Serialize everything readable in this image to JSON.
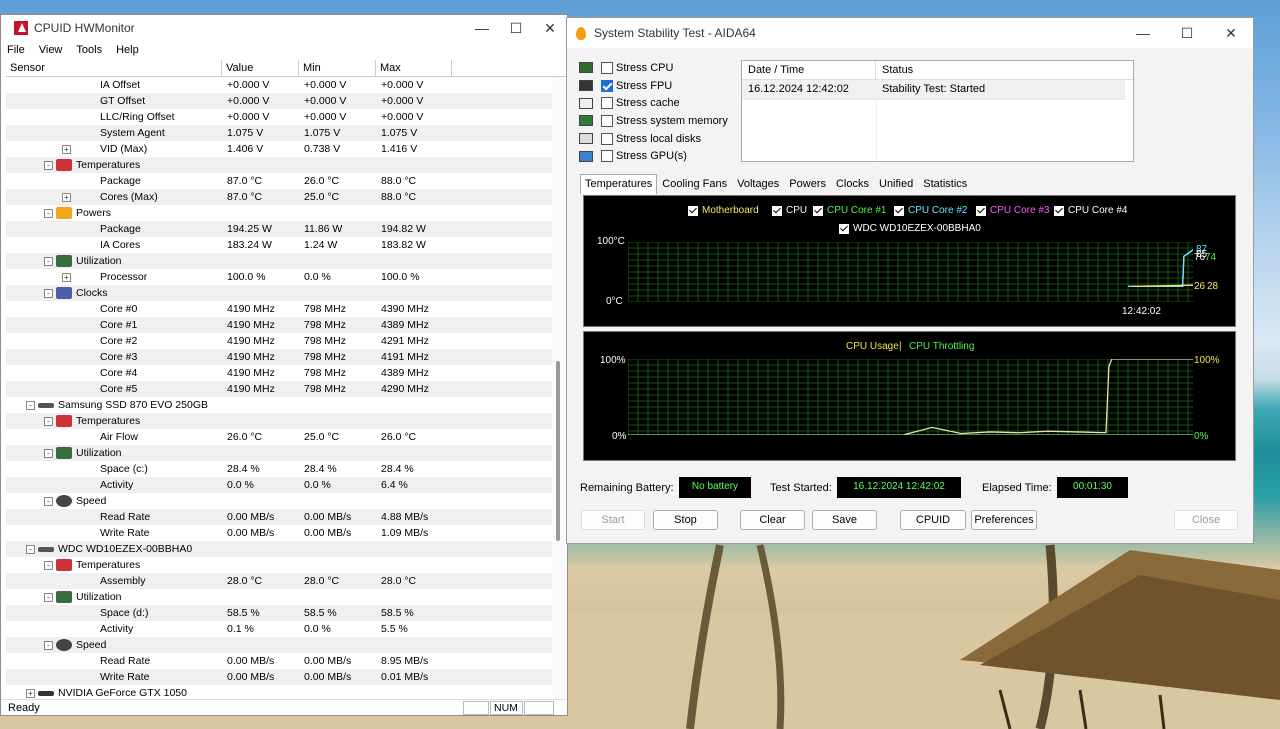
{
  "hw": {
    "title": "CPUID HWMonitor",
    "menu": [
      "File",
      "View",
      "Tools",
      "Help"
    ],
    "columns": [
      "Sensor",
      "Value",
      "Min",
      "Max"
    ],
    "rows": [
      {
        "lvl": 3,
        "label": "IA Offset",
        "v": "+0.000 V",
        "min": "+0.000 V",
        "max": "+0.000 V"
      },
      {
        "lvl": 3,
        "label": "GT Offset",
        "v": "+0.000 V",
        "min": "+0.000 V",
        "max": "+0.000 V"
      },
      {
        "lvl": 3,
        "label": "LLC/Ring Offset",
        "v": "+0.000 V",
        "min": "+0.000 V",
        "max": "+0.000 V"
      },
      {
        "lvl": 3,
        "label": "System Agent",
        "v": "1.075 V",
        "min": "1.075 V",
        "max": "1.075 V"
      },
      {
        "lvl": 3,
        "label": "VID (Max)",
        "v": "1.406 V",
        "min": "0.738 V",
        "max": "1.416 V",
        "exp": "+"
      },
      {
        "lvl": 2,
        "label": "Temperatures",
        "icon": "thermometer",
        "exp": "-"
      },
      {
        "lvl": 3,
        "label": "Package",
        "v": "87.0 °C",
        "min": "26.0 °C",
        "max": "88.0 °C"
      },
      {
        "lvl": 3,
        "label": "Cores (Max)",
        "v": "87.0 °C",
        "min": "25.0 °C",
        "max": "88.0 °C",
        "exp": "+"
      },
      {
        "lvl": 2,
        "label": "Powers",
        "icon": "power",
        "exp": "-"
      },
      {
        "lvl": 3,
        "label": "Package",
        "v": "194.25 W",
        "min": "11.86 W",
        "max": "194.82 W"
      },
      {
        "lvl": 3,
        "label": "IA Cores",
        "v": "183.24 W",
        "min": "1.24 W",
        "max": "183.82 W"
      },
      {
        "lvl": 2,
        "label": "Utilization",
        "icon": "utilization",
        "exp": "-"
      },
      {
        "lvl": 3,
        "label": "Processor",
        "v": "100.0 %",
        "min": "0.0 %",
        "max": "100.0 %",
        "exp": "+"
      },
      {
        "lvl": 2,
        "label": "Clocks",
        "icon": "clock",
        "exp": "-"
      },
      {
        "lvl": 3,
        "label": "Core #0",
        "v": "4190 MHz",
        "min": "798 MHz",
        "max": "4390 MHz"
      },
      {
        "lvl": 3,
        "label": "Core #1",
        "v": "4190 MHz",
        "min": "798 MHz",
        "max": "4389 MHz"
      },
      {
        "lvl": 3,
        "label": "Core #2",
        "v": "4190 MHz",
        "min": "798 MHz",
        "max": "4291 MHz"
      },
      {
        "lvl": 3,
        "label": "Core #3",
        "v": "4190 MHz",
        "min": "798 MHz",
        "max": "4191 MHz"
      },
      {
        "lvl": 3,
        "label": "Core #4",
        "v": "4190 MHz",
        "min": "798 MHz",
        "max": "4389 MHz"
      },
      {
        "lvl": 3,
        "label": "Core #5",
        "v": "4190 MHz",
        "min": "798 MHz",
        "max": "4290 MHz"
      },
      {
        "lvl": 1,
        "label": "Samsung SSD 870 EVO 250GB",
        "icon": "drive",
        "exp": "-"
      },
      {
        "lvl": 2,
        "label": "Temperatures",
        "icon": "thermometer",
        "exp": "-"
      },
      {
        "lvl": 3,
        "label": "Air Flow",
        "v": "26.0 °C",
        "min": "25.0 °C",
        "max": "26.0 °C"
      },
      {
        "lvl": 2,
        "label": "Utilization",
        "icon": "utilization",
        "exp": "-"
      },
      {
        "lvl": 3,
        "label": "Space (c:)",
        "v": "28.4 %",
        "min": "28.4 %",
        "max": "28.4 %"
      },
      {
        "lvl": 3,
        "label": "Activity",
        "v": "0.0 %",
        "min": "0.0 %",
        "max": "6.4 %"
      },
      {
        "lvl": 2,
        "label": "Speed",
        "icon": "speed",
        "exp": "-"
      },
      {
        "lvl": 3,
        "label": "Read Rate",
        "v": "0.00 MB/s",
        "min": "0.00 MB/s",
        "max": "4.88 MB/s"
      },
      {
        "lvl": 3,
        "label": "Write Rate",
        "v": "0.00 MB/s",
        "min": "0.00 MB/s",
        "max": "1.09 MB/s"
      },
      {
        "lvl": 1,
        "label": "WDC WD10EZEX-00BBHA0",
        "icon": "drive",
        "exp": "-"
      },
      {
        "lvl": 2,
        "label": "Temperatures",
        "icon": "thermometer",
        "exp": "-"
      },
      {
        "lvl": 3,
        "label": "Assembly",
        "v": "28.0 °C",
        "min": "28.0 °C",
        "max": "28.0 °C"
      },
      {
        "lvl": 2,
        "label": "Utilization",
        "icon": "utilization",
        "exp": "-"
      },
      {
        "lvl": 3,
        "label": "Space (d:)",
        "v": "58.5 %",
        "min": "58.5 %",
        "max": "58.5 %"
      },
      {
        "lvl": 3,
        "label": "Activity",
        "v": "0.1 %",
        "min": "0.0 %",
        "max": "5.5 %"
      },
      {
        "lvl": 2,
        "label": "Speed",
        "icon": "speed",
        "exp": "-"
      },
      {
        "lvl": 3,
        "label": "Read Rate",
        "v": "0.00 MB/s",
        "min": "0.00 MB/s",
        "max": "8.95 MB/s"
      },
      {
        "lvl": 3,
        "label": "Write Rate",
        "v": "0.00 MB/s",
        "min": "0.00 MB/s",
        "max": "0.01 MB/s"
      },
      {
        "lvl": 1,
        "label": "NVIDIA GeForce GTX 1050",
        "icon": "gpu",
        "exp": "+"
      }
    ],
    "status": {
      "ready": "Ready",
      "num": "NUM"
    }
  },
  "aida": {
    "title": "System Stability Test - AIDA64",
    "stress": [
      {
        "label": "Stress CPU",
        "checked": false,
        "icon": "cpu-icon"
      },
      {
        "label": "Stress FPU",
        "checked": true,
        "icon": "fpu-icon"
      },
      {
        "label": "Stress cache",
        "checked": false,
        "icon": "cache-icon"
      },
      {
        "label": "Stress system memory",
        "checked": false,
        "icon": "memory-icon"
      },
      {
        "label": "Stress local disks",
        "checked": false,
        "icon": "disk-icon"
      },
      {
        "label": "Stress GPU(s)",
        "checked": false,
        "icon": "monitor-icon"
      }
    ],
    "log": {
      "headers": [
        "Date / Time",
        "Status"
      ],
      "rows": [
        [
          "16.12.2024 12:42:02",
          "Stability Test: Started"
        ]
      ]
    },
    "tabs": [
      "Temperatures",
      "Cooling Fans",
      "Voltages",
      "Powers",
      "Clocks",
      "Unified",
      "Statistics"
    ],
    "temp_legend": [
      {
        "label": "Motherboard",
        "color": "#f5e56b"
      },
      {
        "label": "CPU",
        "color": "#ffffff"
      },
      {
        "label": "CPU Core #1",
        "color": "#54f054"
      },
      {
        "label": "CPU Core #2",
        "color": "#61e6ff"
      },
      {
        "label": "CPU Core #3",
        "color": "#ff5bff"
      },
      {
        "label": "CPU Core #4",
        "color": "#ffffff"
      },
      {
        "label": "WDC WD10EZEX-00BBHA0",
        "color": "#ffffff"
      }
    ],
    "temp_axis": {
      "top": "100°C",
      "bottom": "0°C",
      "time": "12:42:02"
    },
    "temp_right": {
      "a": "87",
      "b": "85",
      "c": "76",
      "d": "74",
      "e": "26",
      "f": "28"
    },
    "usage_legend": {
      "usage": "CPU Usage",
      "sep": "|",
      "throttle": "CPU Throttling"
    },
    "usage_axis": {
      "top_l": "100%",
      "bottom_l": "0%",
      "top_r": "100%",
      "bottom_r": "0%"
    },
    "info": {
      "battery_label": "Remaining Battery:",
      "battery": "No battery",
      "started_label": "Test Started:",
      "started": "16.12.2024 12:42:02",
      "elapsed_label": "Elapsed Time:",
      "elapsed": "00:01:30"
    },
    "buttons": {
      "start": "Start",
      "stop": "Stop",
      "clear": "Clear",
      "save": "Save",
      "cpuid": "CPUID",
      "prefs": "Preferences",
      "close": "Close"
    }
  },
  "chart_data": [
    {
      "type": "line",
      "title": "",
      "series": [
        {
          "name": "CPU Core #1",
          "x": [
            0,
            84,
            86,
            100
          ],
          "values": [
            26,
            26,
            76,
            87
          ]
        },
        {
          "name": "Motherboard",
          "x": [
            0,
            100
          ],
          "values": [
            26,
            28
          ]
        }
      ],
      "ylim": [
        0,
        100
      ],
      "ylabel": ""
    },
    {
      "type": "line",
      "title": "CPU Usage",
      "series": [
        {
          "name": "CPU Usage",
          "x": [
            0,
            10,
            20,
            30,
            40,
            50,
            60,
            70,
            71,
            72,
            100
          ],
          "values": [
            0,
            10,
            2,
            4,
            3,
            5,
            4,
            3,
            90,
            100,
            100
          ]
        },
        {
          "name": "CPU Throttling",
          "x": [
            0,
            100
          ],
          "values": [
            0,
            0
          ]
        }
      ],
      "ylim": [
        0,
        100
      ]
    }
  ]
}
